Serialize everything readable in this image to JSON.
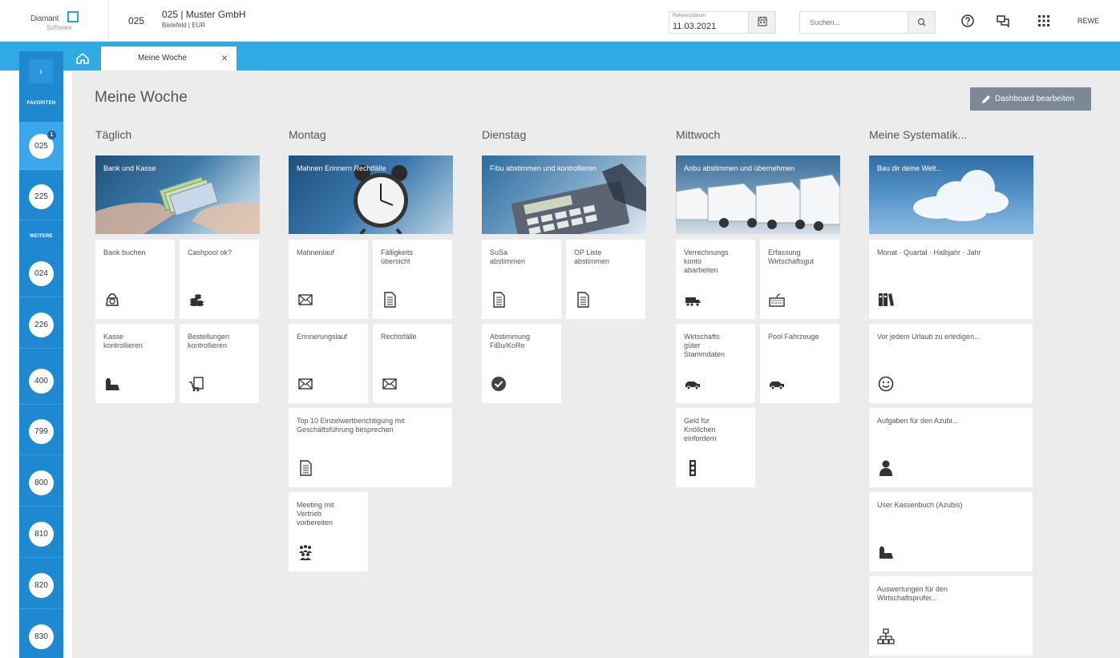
{
  "header": {
    "logo": {
      "line1": "Diamant",
      "line2": "Software"
    },
    "client_number": "025",
    "client_name": "025 | Muster GmbH",
    "client_sub": "Bielefeld | EUR",
    "ref_date_label": "Referenzdatum",
    "ref_date_value": "11.03.2021",
    "search_placeholder": "Suchen...",
    "user": "REWE",
    "icons": [
      "calendar-icon",
      "search-icon",
      "help-icon",
      "chat-icon",
      "apps-grid-icon"
    ]
  },
  "tabs": [
    {
      "label": "Meine Woche",
      "active": true
    }
  ],
  "sidebar": {
    "expand": "›",
    "favorites_label": "FAVORITEN",
    "favorites": [
      {
        "label": "025",
        "badge": "1"
      },
      {
        "label": "225"
      }
    ],
    "more_label": "WEITERE",
    "more": [
      {
        "label": "024"
      },
      {
        "label": "226"
      },
      {
        "label": "400"
      },
      {
        "label": "799"
      },
      {
        "label": "800"
      },
      {
        "label": "810"
      },
      {
        "label": "820"
      },
      {
        "label": "830"
      }
    ]
  },
  "page": {
    "title": "Meine Woche",
    "edit_button": "Dashboard bearbeiten"
  },
  "columns": [
    {
      "title": "Täglich",
      "banner": "Bank und Kasse",
      "tiles": [
        {
          "label": "Bank buchen",
          "icon": "money-bag-icon"
        },
        {
          "label": "Cashpool ok?",
          "icon": "coins-icon"
        },
        {
          "label": "Kasse\nkontrollieren",
          "icon": "cash-register-icon"
        },
        {
          "label": "Bestellungen\nkontrollieren",
          "icon": "order-cart-icon"
        }
      ]
    },
    {
      "title": "Montag",
      "banner": "Mahnen Erinnern Rechtfälle",
      "tiles": [
        {
          "label": "Mahnenlauf",
          "icon": "envelope-icon"
        },
        {
          "label": "Fälligkeits\nübersicht",
          "icon": "document-icon"
        },
        {
          "label": "Erinnerungslauf",
          "icon": "envelope-icon"
        },
        {
          "label": "Rechtsfälle",
          "icon": "envelope-icon"
        },
        {
          "label": "Top 10 Einzelwertberichtigung mit\nGeschäftsführung besprechen",
          "icon": "document-icon"
        },
        {
          "label": "Meeting mit\nVertrieb\nvorbereiten",
          "icon": "people-group-icon"
        }
      ]
    },
    {
      "title": "Dienstag",
      "banner": "Fibu abstimmen und kontrollieren",
      "tiles": [
        {
          "label": "SuSa\nabstimmen",
          "icon": "document-icon"
        },
        {
          "label": "OP Liste\nabstimmen",
          "icon": "document-icon"
        },
        {
          "label": "Abstimmung\nFiBu/KoRe",
          "icon": "check-circle-icon"
        }
      ]
    },
    {
      "title": "Mittwoch",
      "banner": "Anbu abstimmen und übernehmen",
      "tiles": [
        {
          "label": "Verrechnungs\nkonto\nabarbeiten",
          "icon": "truck-icon"
        },
        {
          "label": "Erfassung\nWirtschaftsgut",
          "icon": "keyboard-icon"
        },
        {
          "label": "Wirtschafts\ngüter\nStammdaten",
          "icon": "car-icon"
        },
        {
          "label": "Pool Fahrzeuge",
          "icon": "car-icon"
        },
        {
          "label": "Geld für\nKnöllchen\neinfordern",
          "icon": "traffic-light-icon"
        }
      ]
    },
    {
      "title": "Meine Systematik...",
      "banner": "Bau dir deine Welt...",
      "tiles": [
        {
          "label": "Monat · Quartal · Halbjahr · Jahr",
          "icon": "binders-icon"
        },
        {
          "label": "Vor jedem Urlaub zu erledigen...",
          "icon": "smiley-icon"
        },
        {
          "label": "Aufgaben für den Azubi...",
          "icon": "person-icon"
        },
        {
          "label": "User Kassenbuch (Azubis)",
          "icon": "cash-register-icon"
        },
        {
          "label": "Auswertungen für den\nWirtschaftsprufer...",
          "icon": "org-chart-icon"
        }
      ]
    }
  ]
}
